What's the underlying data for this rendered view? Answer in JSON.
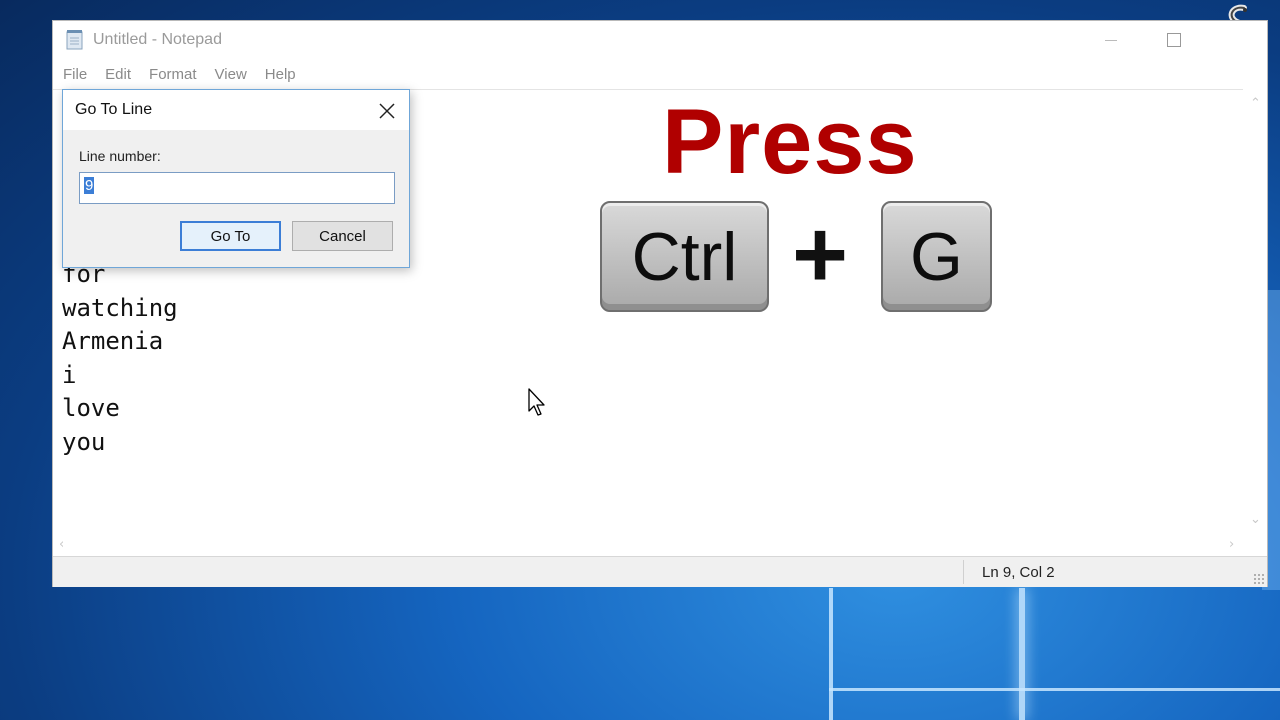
{
  "window": {
    "title": "Untitled - Notepad",
    "menu": [
      "File",
      "Edit",
      "Format",
      "View",
      "Help"
    ]
  },
  "editor": {
    "lines": [
      "for",
      "watching",
      "Armenia",
      "i",
      "love",
      "you"
    ]
  },
  "statusbar": {
    "position": "Ln 9, Col 2"
  },
  "dialog": {
    "title": "Go To Line",
    "label": "Line number:",
    "value": "9",
    "goto_label": "Go To",
    "cancel_label": "Cancel"
  },
  "overlay": {
    "press": "Press",
    "key1": "Ctrl",
    "plus": "+",
    "key2": "G"
  },
  "colors": {
    "accent": "#3c7ed6",
    "press_red": "#b00000"
  }
}
